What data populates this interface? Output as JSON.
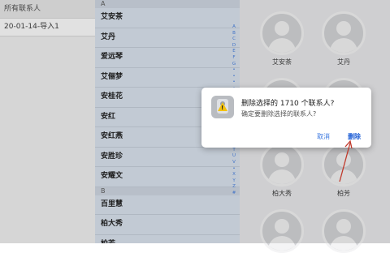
{
  "groups": {
    "header": "所有联系人",
    "items": [
      "20-01-14-导入1"
    ]
  },
  "contacts": {
    "sections": [
      {
        "letter": "A",
        "names": [
          "艾安茶",
          "艾丹",
          "爱远琴",
          "艾俪梦",
          "安桂花",
          "安红",
          "安红燕",
          "安胜珍",
          "安耀文"
        ]
      },
      {
        "letter": "B",
        "names": [
          "百里慧",
          "柏大秀",
          "柏芳"
        ]
      }
    ],
    "index": [
      "A",
      "B",
      "C",
      "D",
      "E",
      "F",
      "G",
      "•",
      "•",
      "•",
      "•",
      "•",
      "•",
      "•",
      "•",
      "•",
      "•",
      "•",
      "R",
      "S",
      "T",
      "U",
      "V",
      "•",
      "X",
      "Y",
      "Z",
      "#"
    ]
  },
  "cards": [
    {
      "name": "艾安茶"
    },
    {
      "name": "艾丹"
    },
    {
      "name": ""
    },
    {
      "name": ""
    },
    {
      "name": "柏大秀"
    },
    {
      "name": "柏芳"
    },
    {
      "name": ""
    },
    {
      "name": ""
    }
  ],
  "dialog": {
    "title": "删除选择的 1710 个联系人?",
    "message": "确定要删除选择的联系人?",
    "cancel": "取消",
    "delete": "删除"
  },
  "colors": {
    "accent": "#3b78e0",
    "warning": "#f4c20d",
    "arrow": "#c0392b"
  }
}
